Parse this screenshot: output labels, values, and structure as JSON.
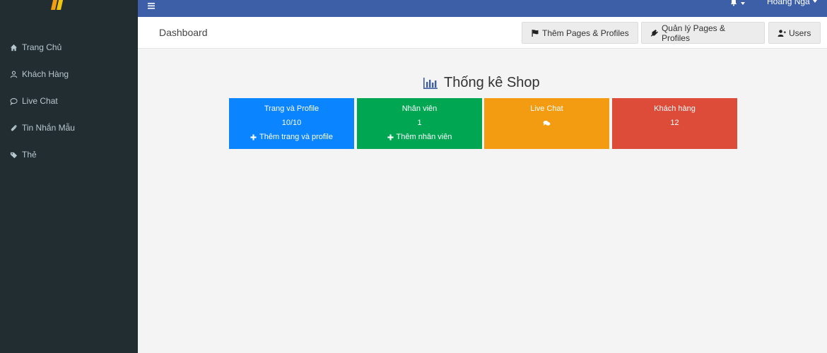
{
  "sidebar": {
    "items": [
      {
        "label": "Trang Chủ",
        "icon": "home-icon"
      },
      {
        "label": "Khách Hàng",
        "icon": "user-icon"
      },
      {
        "label": "Live Chat",
        "icon": "comment-icon"
      },
      {
        "label": "Tin Nhắn Mẫu",
        "icon": "paperclip-icon"
      },
      {
        "label": "Thẻ",
        "icon": "tags-icon"
      }
    ]
  },
  "topbar": {
    "user_name": "Hoàng Nga"
  },
  "header": {
    "title": "Dashboard",
    "buttons": {
      "add_pages": "Thêm Pages & Profiles",
      "manage_pages": "Quản lý Pages & Profiles",
      "users": "Users"
    }
  },
  "stats": {
    "title": "Thống kê Shop",
    "cards": [
      {
        "title": "Trang và Profile",
        "value": "10/10",
        "action": "Thêm trang và profile",
        "color": "#0a84ff"
      },
      {
        "title": "Nhân viên",
        "value": "1",
        "action": "Thêm nhân viên",
        "color": "#00a652"
      },
      {
        "title": "Live Chat",
        "icon": "comments-icon",
        "color": "#f39c12"
      },
      {
        "title": "Khách hàng",
        "value": "12",
        "color": "#dd4b39"
      }
    ]
  },
  "colors": {
    "sidebar_bg": "#222d32",
    "topbar_bg": "#3c5fa8",
    "content_bg": "#f4f4f4"
  }
}
